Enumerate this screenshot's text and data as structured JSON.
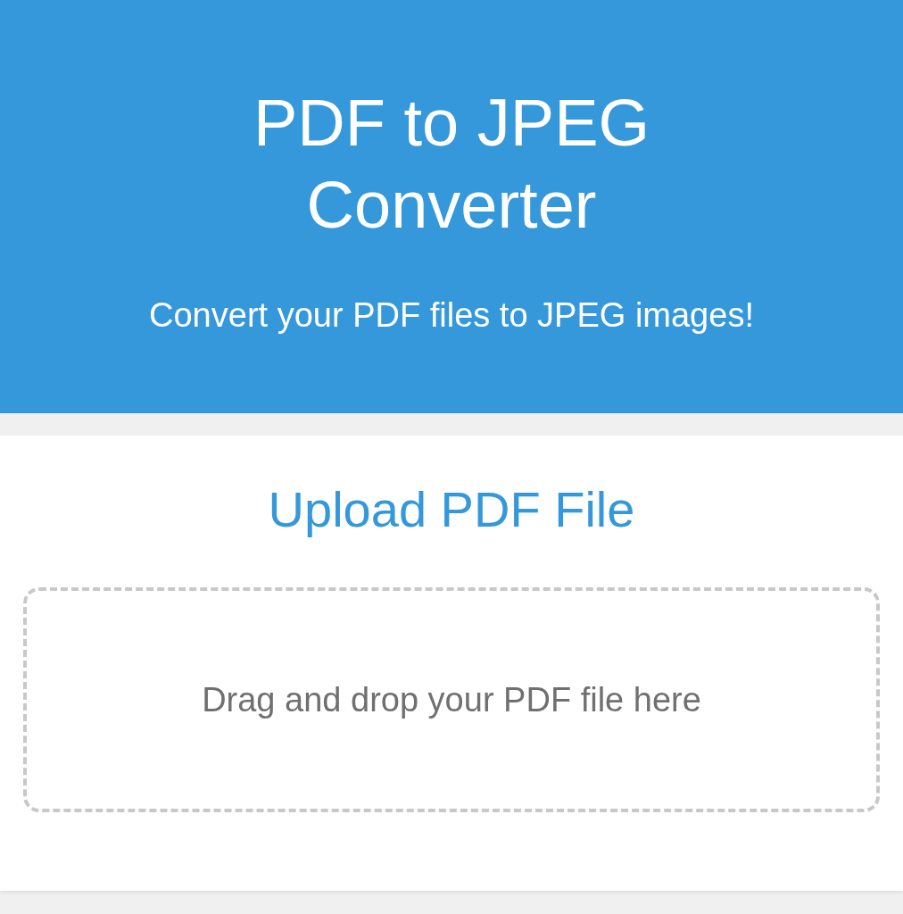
{
  "header": {
    "title": "PDF to JPEG Converter",
    "subtitle": "Convert your PDF files to JPEG images!"
  },
  "upload": {
    "heading": "Upload PDF File",
    "dropzone_text": "Drag and drop your PDF file here"
  }
}
